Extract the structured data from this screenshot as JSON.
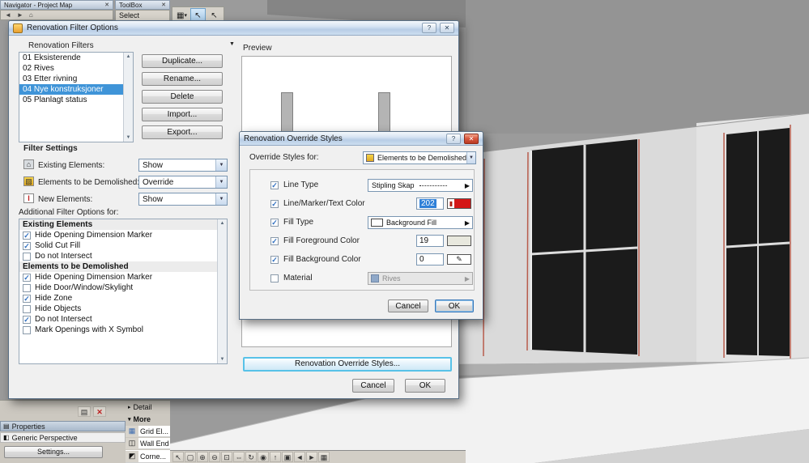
{
  "top_bars": {
    "navigator_title": "Navigator - Project Map",
    "toolbox_title": "ToolBox",
    "select_label": "Select",
    "close_glyph": "✕",
    "nav_icons": [
      {
        "name": "back-icon",
        "glyph": "◄"
      },
      {
        "name": "forward-icon",
        "glyph": "►"
      },
      {
        "name": "home-icon",
        "glyph": "⌂"
      }
    ],
    "float_toolbar": {
      "arrow_combo_glyph": "▦",
      "combo_arrow": "▾",
      "active_tool_glyph": "↖",
      "secondary_tool_glyph": "↖"
    }
  },
  "filter_dialog": {
    "title": "Renovation Filter Options",
    "help_glyph": "?",
    "close_glyph": "✕",
    "filters_heading": "Renovation Filters",
    "flyout_glyph": "▼",
    "filters": [
      "01 Eksisterende",
      "02 Rives",
      "03 Etter rivning",
      "04 Nye konstruksjoner",
      "05 Planlagt status"
    ],
    "selected_index": 3,
    "buttons": {
      "duplicate": "Duplicate...",
      "rename": "Rename...",
      "delete": "Delete",
      "import": "Import...",
      "export": "Export..."
    },
    "preview_label": "Preview",
    "filter_settings_heading": "Filter Settings",
    "settings": [
      {
        "label": "Existing Elements:",
        "value": "Show"
      },
      {
        "label": "Elements to be Demolished:",
        "value": "Override"
      },
      {
        "label": "New Elements:",
        "value": "Show"
      }
    ],
    "additional_heading": "Additional Filter Options for:",
    "options": [
      {
        "label": "Existing Elements",
        "header": true
      },
      {
        "label": "Hide Opening Dimension Marker",
        "checked": true
      },
      {
        "label": "Solid Cut Fill",
        "checked": true
      },
      {
        "label": "Do not Intersect",
        "checked": false
      },
      {
        "label": "Elements to be Demolished",
        "header": true
      },
      {
        "label": "Hide Opening Dimension Marker",
        "checked": true
      },
      {
        "label": "Hide Door/Window/Skylight",
        "checked": false
      },
      {
        "label": "Hide Zone",
        "checked": true
      },
      {
        "label": "Hide Objects",
        "checked": false
      },
      {
        "label": "Do not Intersect",
        "checked": true
      },
      {
        "label": "Mark Openings with X Symbol",
        "checked": false
      }
    ],
    "override_styles_button": "Renovation Override Styles...",
    "cancel_label": "Cancel",
    "ok_label": "OK"
  },
  "override_dialog": {
    "title": "Renovation Override Styles",
    "help_glyph": "?",
    "close_glyph": "✕",
    "for_label": "Override Styles for:",
    "for_value": "Elements to be Demolished",
    "line_type": {
      "label": "Line Type",
      "checked": true,
      "value": "Stipling Skap"
    },
    "line_color": {
      "label": "Line/Marker/Text Color",
      "checked": true,
      "value": "202",
      "color": "#d41616"
    },
    "fill_type": {
      "label": "Fill Type",
      "checked": true,
      "value": "Background Fill"
    },
    "fill_fg": {
      "label": "Fill Foreground Color",
      "checked": true,
      "value": "19",
      "color": "#e8e8de"
    },
    "fill_bg": {
      "label": "Fill Background Color",
      "checked": true,
      "value": "0",
      "pen_glyph": "✎"
    },
    "material": {
      "label": "Material",
      "checked": false,
      "value": "Rives"
    },
    "cancel_label": "Cancel",
    "ok_label": "OK"
  },
  "dock": {
    "print_glyph": "▤",
    "close_glyph": "✕",
    "properties_title": "Properties",
    "properties_icon_glyph": "▤",
    "perspective": "Generic Perspective",
    "perspective_icon_glyph": "◧",
    "settings_label": "Settings...",
    "detail_label": "Detail",
    "detail_chevron": "▸",
    "more_label": "More",
    "more_chevron": "▾",
    "tools": [
      {
        "label": "Grid El...",
        "glyph": "▦"
      },
      {
        "label": "Wall End",
        "glyph": "◫"
      },
      {
        "label": "Corne...",
        "glyph": "◩"
      }
    ]
  },
  "bottom_toolbar": {
    "icons": [
      {
        "name": "select-arrow",
        "glyph": "↖"
      },
      {
        "name": "marquee",
        "glyph": "▢"
      },
      {
        "name": "zoom-in",
        "glyph": "⊕"
      },
      {
        "name": "zoom-out",
        "glyph": "⊖"
      },
      {
        "name": "fit-view",
        "glyph": "⊡"
      },
      {
        "name": "pan",
        "glyph": "⇔"
      },
      {
        "name": "orbit",
        "glyph": "↻"
      },
      {
        "name": "look-around",
        "glyph": "◉"
      },
      {
        "name": "walk",
        "glyph": "↑"
      },
      {
        "name": "camera",
        "glyph": "▣"
      },
      {
        "name": "previous-view",
        "glyph": "◄"
      },
      {
        "name": "next-view",
        "glyph": "►"
      },
      {
        "name": "full-view",
        "glyph": "▦"
      }
    ]
  },
  "colors": {
    "selection_blue": "#3f94d8",
    "line_override_red": "#d41616",
    "fill_foreground": "#e8e8de",
    "highlight_button_border": "#58c2e8"
  }
}
